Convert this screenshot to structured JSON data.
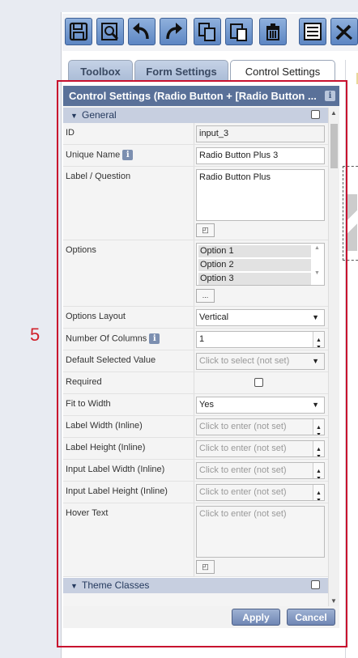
{
  "toolbar": {
    "buttons": [
      {
        "name": "save-icon"
      },
      {
        "name": "preview-icon"
      },
      {
        "name": "undo-icon"
      },
      {
        "name": "redo-icon"
      },
      {
        "name": "copy-icon"
      },
      {
        "name": "paste-icon"
      },
      {
        "name": "delete-icon"
      },
      {
        "name": "list-icon"
      },
      {
        "name": "tools-icon"
      }
    ]
  },
  "tabs": [
    "Toolbox",
    "Form Settings",
    "Control Settings"
  ],
  "panel": {
    "title": "Control Settings (Radio Button + [Radio Button ...",
    "info": "i",
    "general": {
      "heading": "General",
      "id_label": "ID",
      "id_value": "input_3",
      "unique_label": "Unique Name",
      "unique_value": "Radio Button Plus 3",
      "label_label": "Label / Question",
      "label_value": "Radio Button Plus",
      "options_label": "Options",
      "options": [
        "Option 1",
        "Option 2",
        "Option 3"
      ],
      "options_btn": "...",
      "layout_label": "Options Layout",
      "layout_value": "Vertical",
      "columns_label": "Number Of Columns",
      "columns_value": "1",
      "default_label": "Default Selected Value",
      "default_value": "Click to select (not set)",
      "required_label": "Required",
      "fit_label": "Fit to Width",
      "fit_value": "Yes",
      "lw_label": "Label Width (Inline)",
      "lw_value": "Click to enter (not set)",
      "lh_label": "Label Height (Inline)",
      "lh_value": "Click to enter (not set)",
      "ilw_label": "Input Label Width (Inline)",
      "ilw_value": "Click to enter (not set)",
      "ilh_label": "Input Label Height (Inline)",
      "ilh_value": "Click to enter (not set)",
      "hover_label": "Hover Text",
      "hover_value": "Click to enter (not set)"
    },
    "theme": {
      "heading": "Theme Classes"
    },
    "apply": "Apply",
    "cancel": "Cancel"
  },
  "annotation": {
    "number": "5",
    "color": "#c8102e"
  }
}
